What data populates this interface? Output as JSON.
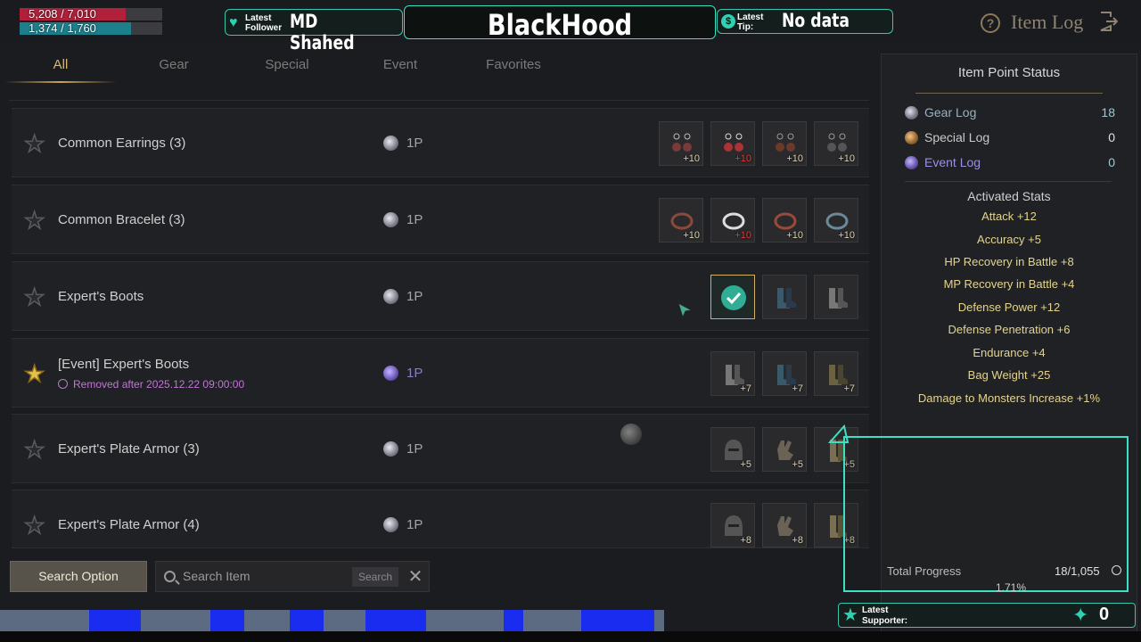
{
  "overlay": {
    "hp_text": "5,208 / 7,010",
    "hp_fraction": 0.743,
    "mp_text": "1,374 / 1,760",
    "mp_fraction": 0.781,
    "follower_label_1": "Latest",
    "follower_label_2": "Follower",
    "follower_name": "MD Shahed",
    "channel_name": "BlackHood",
    "tip_label_1": "Latest",
    "tip_label_2": "Tip:",
    "tip_value": "No data",
    "supporter_label_1": "Latest",
    "supporter_label_2": "Supporter:",
    "supporter_count": "0",
    "accent_color": "#3ee0c4"
  },
  "header": {
    "title": "Item Log",
    "help_icon": "question-circle-icon",
    "exit_icon": "exit-door-icon"
  },
  "tabs": [
    {
      "label": "All",
      "active": true
    },
    {
      "label": "Gear",
      "active": false
    },
    {
      "label": "Special",
      "active": false
    },
    {
      "label": "Event",
      "active": false
    },
    {
      "label": "Favorites",
      "active": false
    }
  ],
  "items": [
    {
      "name": "Common Earrings (3)",
      "points": "1P",
      "favorite": false,
      "event": false,
      "sub": "",
      "slots": [
        {
          "lvl": "+10",
          "red": false
        },
        {
          "lvl": "+10",
          "red": true
        },
        {
          "lvl": "+10",
          "red": false
        },
        {
          "lvl": "+10",
          "red": false
        }
      ]
    },
    {
      "name": "Common Bracelet (3)",
      "points": "1P",
      "favorite": false,
      "event": false,
      "sub": "",
      "slots": [
        {
          "lvl": "+10",
          "red": false
        },
        {
          "lvl": "+10",
          "red": true
        },
        {
          "lvl": "+10",
          "red": false
        },
        {
          "lvl": "+10",
          "red": false
        }
      ]
    },
    {
      "name": "Expert's Boots",
      "points": "1P",
      "favorite": false,
      "event": false,
      "sub": "",
      "slots": [
        {
          "lvl": "",
          "red": false,
          "done": true
        },
        {
          "lvl": "",
          "red": false
        },
        {
          "lvl": "",
          "red": false
        }
      ]
    },
    {
      "name": "[Event] Expert's Boots",
      "points": "1P",
      "favorite": true,
      "event": true,
      "sub": "Removed after 2025.12.22 09:00:00",
      "slots": [
        {
          "lvl": "+7",
          "red": false
        },
        {
          "lvl": "+7",
          "red": false
        },
        {
          "lvl": "+7",
          "red": false
        }
      ]
    },
    {
      "name": "Expert's Plate Armor (3)",
      "points": "1P",
      "favorite": false,
      "event": false,
      "sub": "",
      "slots": [
        {
          "lvl": "+5",
          "red": false
        },
        {
          "lvl": "+5",
          "red": false
        },
        {
          "lvl": "+5",
          "red": false
        }
      ]
    },
    {
      "name": "Expert's Plate Armor (4)",
      "points": "1P",
      "favorite": false,
      "event": false,
      "sub": "",
      "slots": [
        {
          "lvl": "+8",
          "red": false
        },
        {
          "lvl": "+8",
          "red": false
        },
        {
          "lvl": "+8",
          "red": false
        }
      ]
    }
  ],
  "search": {
    "option_label": "Search Option",
    "placeholder": "Search Item",
    "button_label": "Search"
  },
  "panel": {
    "title": "Item Point Status",
    "logs": [
      {
        "label": "Gear Log",
        "value": "18"
      },
      {
        "label": "Special Log",
        "value": "0"
      },
      {
        "label": "Event Log",
        "value": "0"
      }
    ],
    "activated_title": "Activated Stats",
    "stats": [
      "Attack +12",
      "Accuracy +5",
      "HP Recovery in Battle +8",
      "MP Recovery in Battle +4",
      "Defense Power +12",
      "Defense Penetration +6",
      "Endurance +4",
      "Bag Weight +25",
      "Damage to Monsters Increase +1%"
    ],
    "total_label": "Total Progress",
    "total_value": "18/1,055",
    "percent": "1.71%"
  }
}
